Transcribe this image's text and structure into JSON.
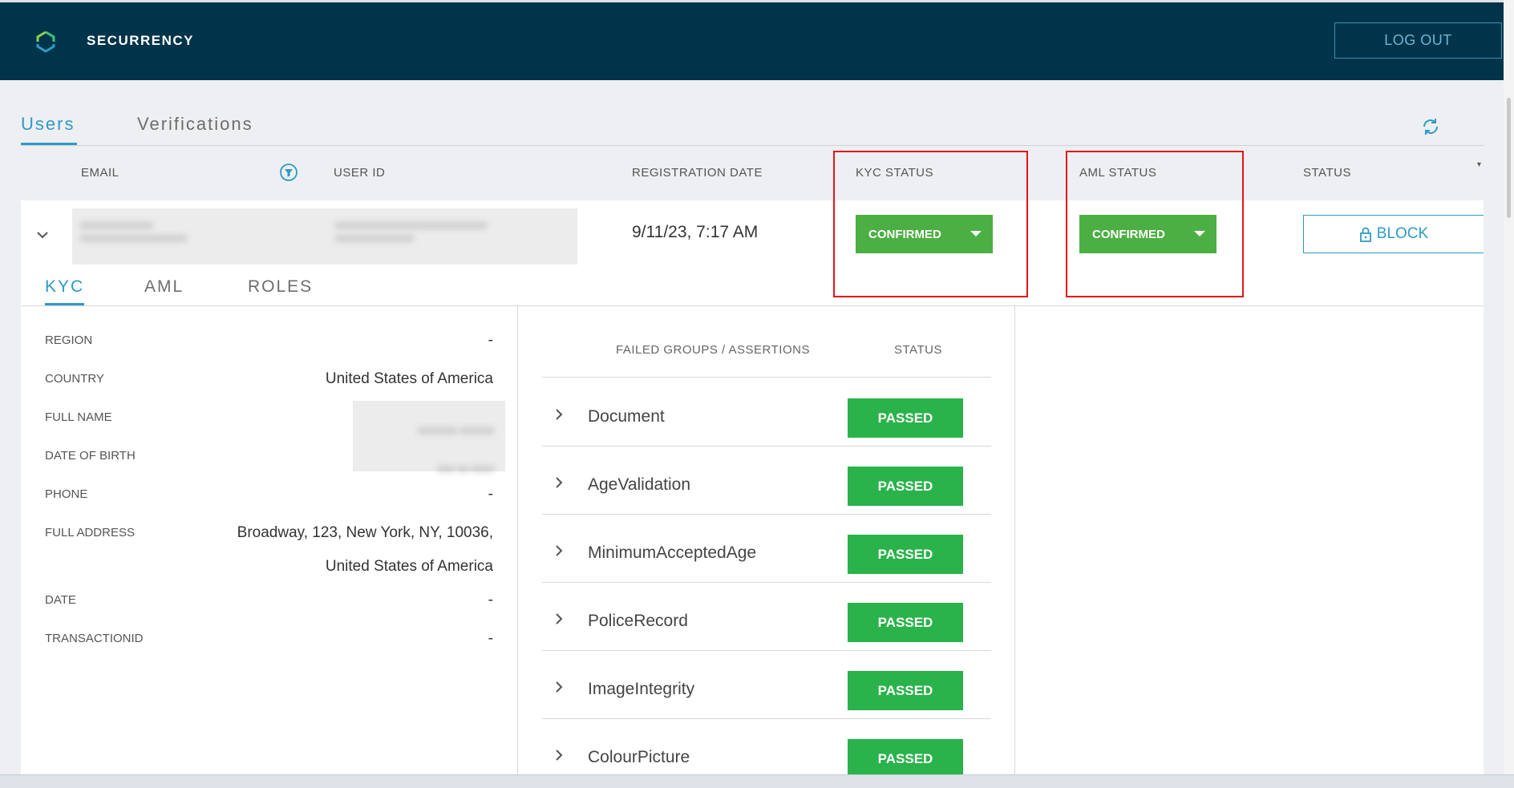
{
  "header": {
    "brand": "SECURRENCY",
    "logout_label": "LOG OUT"
  },
  "tabs": [
    {
      "label": "Users",
      "active": true
    },
    {
      "label": "Verifications",
      "active": false
    }
  ],
  "table": {
    "columns": [
      "EMAIL",
      "USER ID",
      "REGISTRATION DATE",
      "KYC STATUS",
      "AML STATUS",
      "STATUS"
    ],
    "row": {
      "registration_date": "9/11/23, 7:17 AM",
      "kyc_status": "CONFIRMED",
      "aml_status": "CONFIRMED",
      "block_label": "BLOCK"
    }
  },
  "subtabs": [
    {
      "label": "KYC",
      "active": true
    },
    {
      "label": "AML",
      "active": false
    },
    {
      "label": "ROLES",
      "active": false
    }
  ],
  "kyc_details": [
    {
      "label": "REGION",
      "value": "-"
    },
    {
      "label": "COUNTRY",
      "value": "United States of America"
    },
    {
      "label": "FULL NAME",
      "value": ""
    },
    {
      "label": "DATE OF BIRTH",
      "value": ""
    },
    {
      "label": "PHONE",
      "value": "-"
    },
    {
      "label": "FULL ADDRESS",
      "value": "Broadway, 123, New York, NY, 10036,",
      "value2": "United States of America"
    },
    {
      "label": "DATE",
      "value": "-"
    },
    {
      "label": "TRANSACTIONID",
      "value": "-"
    }
  ],
  "assertions": {
    "headers": [
      "FAILED GROUPS / ASSERTIONS",
      "STATUS"
    ],
    "rows": [
      {
        "name": "Document",
        "status": "PASSED"
      },
      {
        "name": "AgeValidation",
        "status": "PASSED"
      },
      {
        "name": "MinimumAcceptedAge",
        "status": "PASSED"
      },
      {
        "name": "PoliceRecord",
        "status": "PASSED"
      },
      {
        "name": "ImageIntegrity",
        "status": "PASSED"
      },
      {
        "name": "ColourPicture",
        "status": "PASSED"
      }
    ]
  },
  "colors": {
    "header_bg": "#00344a",
    "accent": "#2e9bc4",
    "confirmed": "#4caf43",
    "passed": "#29b34a",
    "highlight": "#e8131a"
  }
}
